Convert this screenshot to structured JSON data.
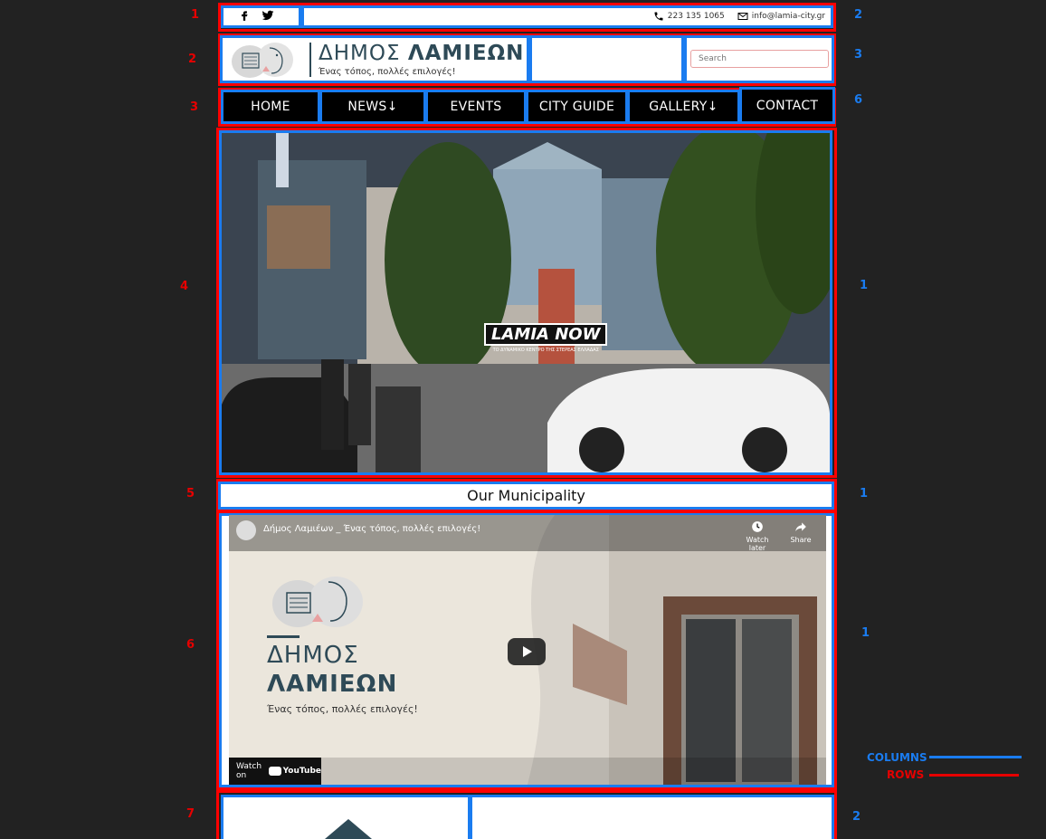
{
  "topbar": {
    "phone": "223 135 1065",
    "email": "info@lamia-city.gr"
  },
  "header": {
    "logo_title_light": "ΔΗΜΟΣ",
    "logo_title_bold": "ΛΑΜΙΕΩΝ",
    "logo_subtitle": "Ένας τόπος, πολλές επιλογές!",
    "search_placeholder": "Search"
  },
  "nav": {
    "items": [
      {
        "label": "HOME"
      },
      {
        "label": "NEWS↓"
      },
      {
        "label": "EVENTS"
      },
      {
        "label": "CITY GUIDE"
      },
      {
        "label": "GALLERY↓"
      },
      {
        "label": "CONTACT"
      }
    ]
  },
  "hero": {
    "brand": "LAMIA NOW",
    "tagline": "ΤΟ ΔΥΝΑΜΙΚΟ ΚΕΝΤΡΟ ΤΗΣ ΣΤΕΡΕΑΣ ΕΛΛΑΔΑΣ"
  },
  "section": {
    "title": "Our Municipality"
  },
  "video": {
    "title": "Δήμος Λαμιέων _ Ένας τόπος, πολλές επιλογές!",
    "watch_later": "Watch later",
    "share": "Share",
    "line1": "ΔΗΜΟΣ",
    "line2": "ΛΑΜΙΕΩΝ",
    "subtitle": "Ένας τόπος, πολλές επιλογές!",
    "watch_on": "Watch on",
    "yt_logo": "YouTube"
  },
  "annotations": {
    "row_numbers": [
      "1",
      "2",
      "3",
      "4",
      "5",
      "6",
      "7"
    ],
    "column_numbers": [
      "2",
      "3",
      "6",
      "1",
      "1",
      "1",
      "2"
    ],
    "legend_columns": "COLUMNS",
    "legend_rows": "ROWS",
    "column_color": "#1a7cf0",
    "row_color": "#ff0000"
  }
}
